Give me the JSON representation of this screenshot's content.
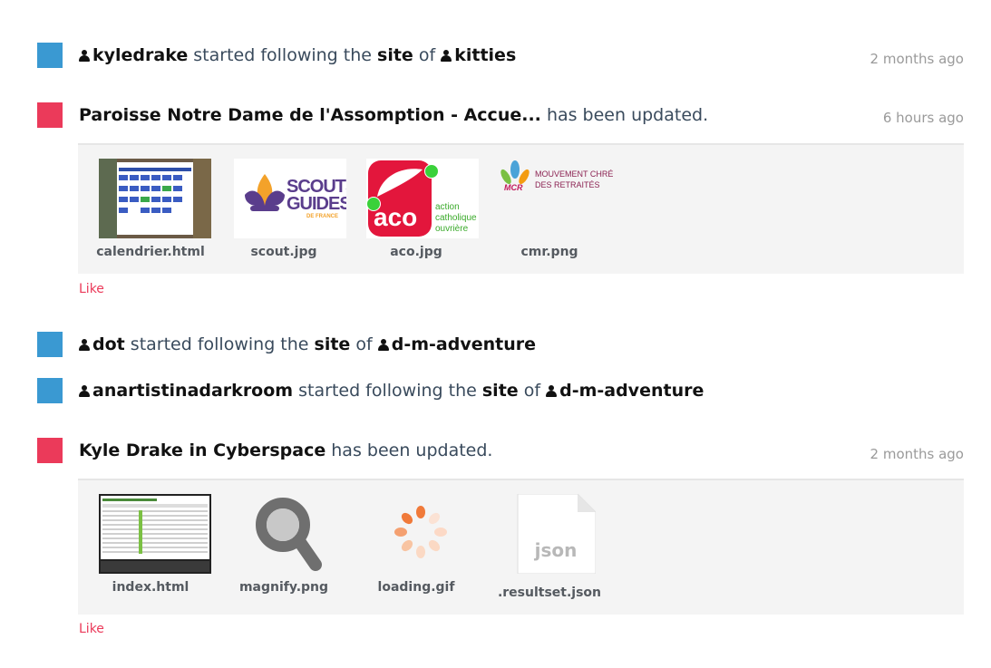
{
  "events": [
    {
      "actor": "kyledrake",
      "verb": "started following the",
      "object": "site",
      "prep": "of",
      "target": "kitties",
      "time": "2 months ago"
    },
    {
      "site": "Paroisse Notre Dame de l'Assomption - Accue...",
      "action": "has been updated.",
      "time": "6 hours ago",
      "files": [
        "calendrier.html",
        "scout.jpg",
        "aco.jpg",
        "cmr.png"
      ],
      "like": "Like",
      "thumbs": {
        "scout_line1": "SCOUTS",
        "scout_line2": "GUIDES",
        "scout_line3": "DE FRANCE",
        "aco_logo": "aco",
        "aco_l1": "action",
        "aco_l2": "catholique",
        "aco_l3": "ouvrière",
        "cmr_l1": "MOUVEMENT CHRÉ",
        "cmr_l2": "DES RETRAITÉS",
        "cmr_mark": "MCR"
      }
    },
    {
      "actor": "dot",
      "verb": "started following the",
      "object": "site",
      "prep": "of",
      "target": "d-m-adventure"
    },
    {
      "actor": "anartistinadarkroom",
      "verb": "started following the",
      "object": "site",
      "prep": "of",
      "target": "d-m-adventure"
    },
    {
      "site": "Kyle Drake in Cyberspace",
      "action": "has been updated.",
      "time": "2 months ago",
      "files": [
        "index.html",
        "magnify.png",
        "loading.gif",
        ".resultset.json"
      ],
      "like": "Like",
      "thumbs": {
        "json_label": "json"
      }
    }
  ],
  "colors": {
    "follow": "#3a99d2",
    "update": "#eb3a5a"
  }
}
